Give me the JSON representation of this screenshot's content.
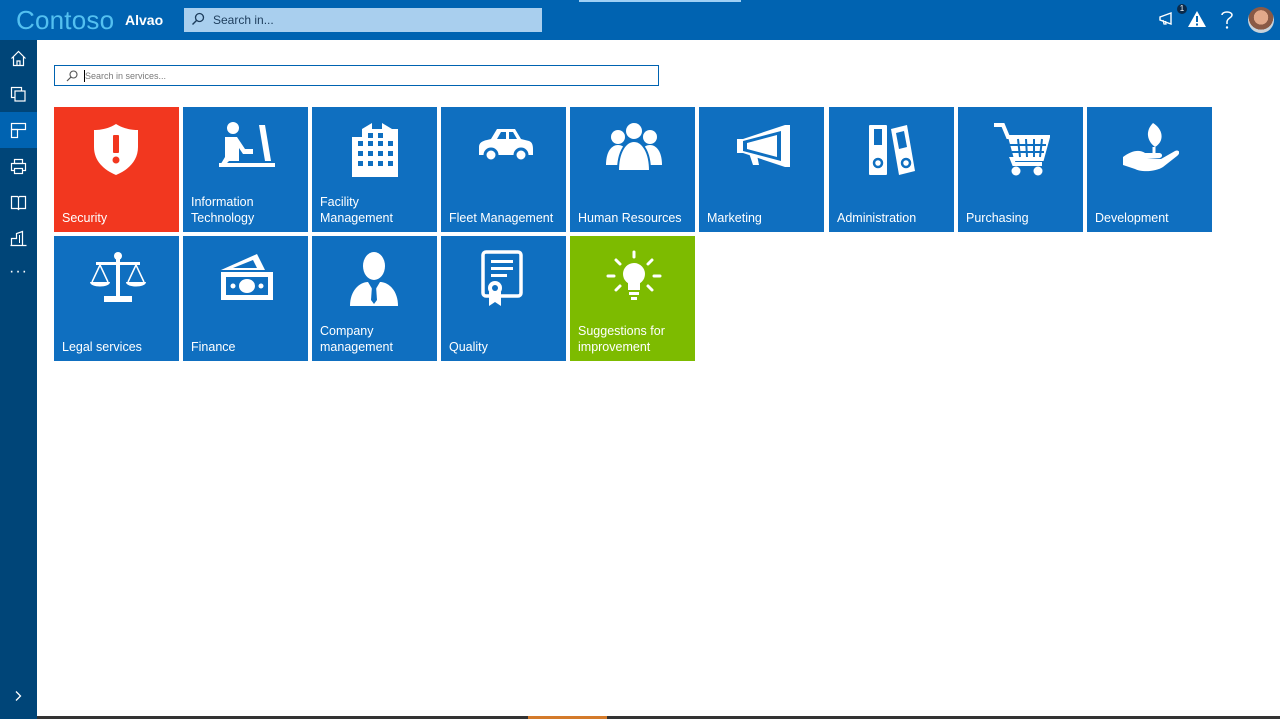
{
  "header": {
    "brand": "Contoso",
    "app_name": "Alvao",
    "search_placeholder": "Search in...",
    "notification_count": "1"
  },
  "sidebar": {
    "items": [
      "home-icon",
      "copy-icon",
      "tiles-icon",
      "print-icon",
      "book-icon",
      "building-icon"
    ],
    "active_index": 2,
    "more": "···"
  },
  "services": {
    "search_placeholder": "Search in services...",
    "tiles": [
      {
        "label": "Security",
        "icon": "shield-alert-icon",
        "color": "#f2371f"
      },
      {
        "label": "Information Technology",
        "icon": "person-computer-icon",
        "color": "#0f6fc0"
      },
      {
        "label": "Facility Management",
        "icon": "building-icon",
        "color": "#0f6fc0"
      },
      {
        "label": "Fleet Management",
        "icon": "car-icon",
        "color": "#0f6fc0"
      },
      {
        "label": "Human Resources",
        "icon": "people-icon",
        "color": "#0f6fc0"
      },
      {
        "label": "Marketing",
        "icon": "megaphone-icon",
        "color": "#0f6fc0"
      },
      {
        "label": "Administration",
        "icon": "binders-icon",
        "color": "#0f6fc0"
      },
      {
        "label": "Purchasing",
        "icon": "cart-icon",
        "color": "#0f6fc0"
      },
      {
        "label": "Development",
        "icon": "hand-plant-icon",
        "color": "#0f6fc0"
      },
      {
        "label": "Legal services",
        "icon": "scales-icon",
        "color": "#0f6fc0"
      },
      {
        "label": "Finance",
        "icon": "money-icon",
        "color": "#0f6fc0"
      },
      {
        "label": "Company management",
        "icon": "manager-icon",
        "color": "#0f6fc0"
      },
      {
        "label": "Quality",
        "icon": "certificate-icon",
        "color": "#0f6fc0"
      },
      {
        "label": "Suggestions for improvement",
        "icon": "lightbulb-icon",
        "color": "#7dbb00"
      }
    ]
  }
}
